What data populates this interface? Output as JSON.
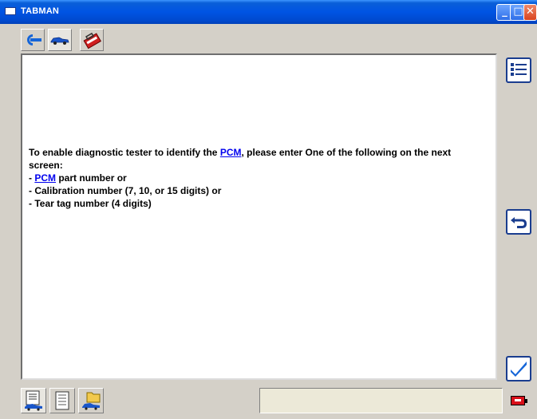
{
  "window": {
    "title": "TABMAN",
    "buttons": {
      "minimize": "_",
      "maximize": "□",
      "close": "✕"
    }
  },
  "top_toolbar": {
    "tools": [
      {
        "icon": "connect-icon",
        "active": false
      },
      {
        "icon": "vehicle-icon",
        "active": true
      },
      {
        "icon": "toolbox-icon",
        "active": false
      }
    ]
  },
  "message": {
    "line1_pre": "To enable diagnostic tester to identify the ",
    "link": "PCM",
    "line1_post": ", please enter One of the following on the next screen:",
    "item1_prefix": "- ",
    "item1_link": "PCM",
    "item1_post": " part number or",
    "item2": "- Calibration number (7, 10, or 15 digits) or",
    "item3": "- Tear tag number (4 digits)"
  },
  "side_buttons": [
    "list-icon",
    "back-arrow-icon",
    "checkmark-icon"
  ],
  "bottom_toolbar": {
    "tools": [
      "vehicle-data-icon",
      "notes-icon",
      "vehicle-folder-icon"
    ],
    "status_text": ""
  },
  "colors": {
    "titlebar": "#0054e3",
    "link": "#0000ee",
    "side_button_border": "#1a3d8f",
    "battery": "#d8101a"
  }
}
